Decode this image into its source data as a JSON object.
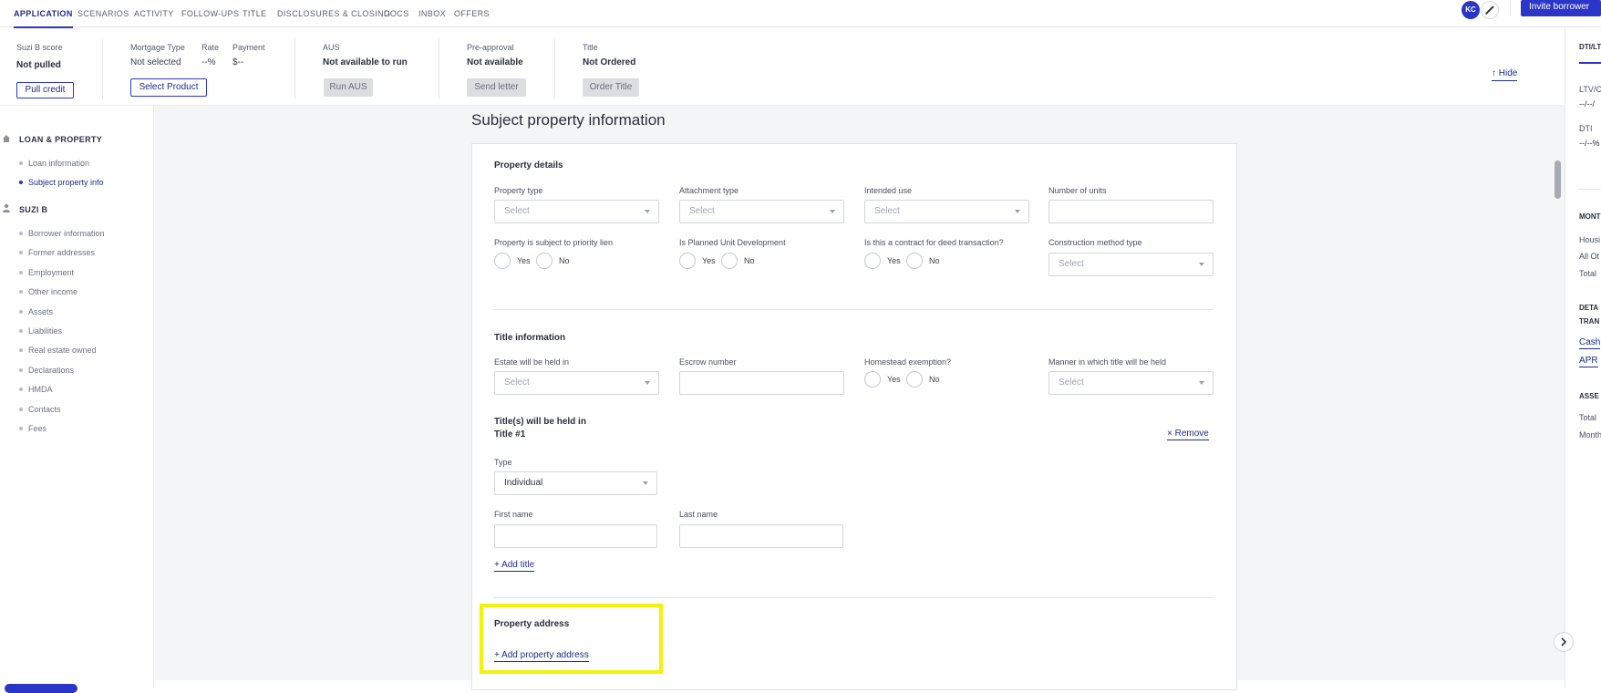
{
  "nav": {
    "tabs": [
      "APPLICATION",
      "SCENARIOS",
      "ACTIVITY",
      "FOLLOW-UPS",
      "TITLE",
      "DISCLOSURES & CLOSING",
      "DOCS",
      "INBOX",
      "OFFERS"
    ],
    "avatar_initials": "KC",
    "invite_button": "Invite borrower"
  },
  "summary": {
    "score_label": "Suzi B score",
    "score_value": "Not pulled",
    "pull_credit": "Pull credit",
    "mortgage_type_label": "Mortgage Type",
    "mortgage_type_value": "Not selected",
    "rate_label": "Rate",
    "rate_value": "--%",
    "payment_label": "Payment",
    "payment_value": "$--",
    "select_product": "Select Product",
    "aus_label": "AUS",
    "aus_value": "Not available to run",
    "run_aus": "Run AUS",
    "preapproval_label": "Pre-approval",
    "preapproval_value": "Not available",
    "send_letter": "Send letter",
    "title_label": "Title",
    "title_value": "Not Ordered",
    "order_title": "Order Title",
    "hide": "Hide"
  },
  "sidebar": {
    "section1": "LOAN & PROPERTY",
    "section1_items": [
      "Loan information",
      "Subject property info"
    ],
    "section2": "SUZI B",
    "section2_items": [
      "Borrower information",
      "Former addresses",
      "Employment",
      "Other income",
      "Assets",
      "Liabilities",
      "Real estate owned",
      "Declarations",
      "HMDA",
      "Contacts",
      "Fees"
    ]
  },
  "page": {
    "title": "Subject property information",
    "property_details": {
      "heading": "Property details",
      "property_type": "Property type",
      "attachment_type": "Attachment type",
      "intended_use": "Intended use",
      "number_of_units": "Number of units",
      "priority_lien": "Property is subject to priority lien",
      "pud": "Is Planned Unit Development",
      "deed_contract": "Is this a contract for deed transaction?",
      "construction_method": "Construction method type"
    },
    "title_information": {
      "heading": "Title information",
      "estate_held_in": "Estate will be held in",
      "escrow_number": "Escrow number",
      "homestead": "Homestead exemption?",
      "manner_title": "Manner in which title will be held",
      "titles_held_in": "Title(s) will be held in",
      "title_1": "Title #1",
      "remove": "Remove",
      "type_label": "Type",
      "type_value": "Individual",
      "first_name": "First name",
      "last_name": "Last name",
      "add_title": "Add title"
    },
    "property_address": {
      "heading": "Property address",
      "add_address": "Add property address"
    },
    "select_placeholder": "Select",
    "yes": "Yes",
    "no": "No"
  },
  "right_panel": {
    "tab": "DTI/LT",
    "ltv_label": "LTV/C",
    "ltv_value": "--/--/",
    "dti_label": "DTI",
    "dti_value": "--/--%",
    "monthly": "MONT",
    "housing": "Housi",
    "all_other": "All Ot",
    "total": "Total",
    "details": "DETA",
    "trans": "TRAN",
    "cash": "Cash",
    "apr": "APR",
    "assets": "ASSE",
    "assets_total": "Total",
    "assets_monthly": "Month"
  },
  "colors": {
    "accent": "#2b36c8",
    "highlight": "#f4f10a",
    "background": "#f4f5f7"
  }
}
